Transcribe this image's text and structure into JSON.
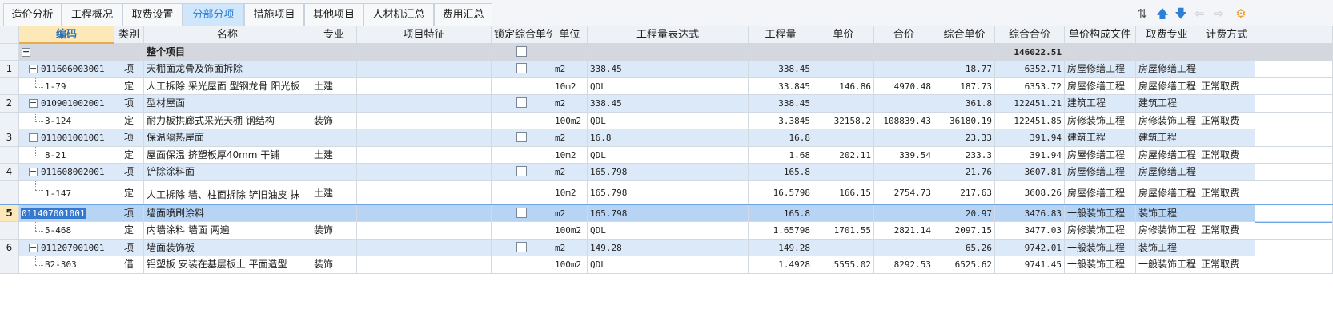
{
  "tabs": [
    {
      "label": "造价分析",
      "active": false
    },
    {
      "label": "工程概况",
      "active": false
    },
    {
      "label": "取费设置",
      "active": false
    },
    {
      "label": "分部分项",
      "active": true
    },
    {
      "label": "措施项目",
      "active": false
    },
    {
      "label": "其他项目",
      "active": false
    },
    {
      "label": "人材机汇总",
      "active": false
    },
    {
      "label": "费用汇总",
      "active": false
    }
  ],
  "toolbar_icons": [
    "sort-icon",
    "move-up-icon",
    "move-down-icon",
    "outdent-icon",
    "indent-icon",
    "settings-icon"
  ],
  "columns": [
    "编码",
    "类别",
    "名称",
    "专业",
    "项目特征",
    "锁定综合单价",
    "单位",
    "工程量表达式",
    "工程量",
    "单价",
    "合价",
    "综合单价",
    "综合合价",
    "单价构成文件",
    "取费专业",
    "计费方式"
  ],
  "total_row": {
    "code": "",
    "name": "整个项目",
    "total": "146022.51"
  },
  "rows": [
    {
      "idx": "1",
      "kind": "item",
      "code": "011606003001",
      "type": "项",
      "name": "天棚面龙骨及饰面拆除",
      "spec": "",
      "unit": "m2",
      "expr": "338.45",
      "qty": "338.45",
      "price": "",
      "amount": "",
      "uprice": "18.77",
      "utotal": "6352.71",
      "file": "房屋修缮工程",
      "fee": "房屋修缮工程",
      "mode": ""
    },
    {
      "idx": "",
      "kind": "quota",
      "code": "1-79",
      "type": "定",
      "name": "人工拆除 采光屋面 型钢龙骨 阳光板",
      "spec": "土建",
      "unit": "10m2",
      "expr": "QDL",
      "qty": "33.845",
      "price": "146.86",
      "amount": "4970.48",
      "uprice": "187.73",
      "utotal": "6353.72",
      "file": "房屋修缮工程",
      "fee": "房屋修缮工程",
      "mode": "正常取费"
    },
    {
      "idx": "2",
      "kind": "item",
      "code": "010901002001",
      "type": "项",
      "name": "型材屋面",
      "spec": "",
      "unit": "m2",
      "expr": "338.45",
      "qty": "338.45",
      "price": "",
      "amount": "",
      "uprice": "361.8",
      "utotal": "122451.21",
      "file": "建筑工程",
      "fee": "建筑工程",
      "mode": ""
    },
    {
      "idx": "",
      "kind": "quota",
      "code": "3-124",
      "type": "定",
      "name": "耐力板拱廊式采光天棚 钢结构",
      "spec": "装饰",
      "unit": "100m2",
      "expr": "QDL",
      "qty": "3.3845",
      "price": "32158.2",
      "amount": "108839.43",
      "uprice": "36180.19",
      "utotal": "122451.85",
      "file": "房修装饰工程",
      "fee": "房修装饰工程",
      "mode": "正常取费"
    },
    {
      "idx": "3",
      "kind": "item",
      "code": "011001001001",
      "type": "项",
      "name": "保温隔热屋面",
      "spec": "",
      "unit": "m2",
      "expr": "16.8",
      "qty": "16.8",
      "price": "",
      "amount": "",
      "uprice": "23.33",
      "utotal": "391.94",
      "file": "建筑工程",
      "fee": "建筑工程",
      "mode": ""
    },
    {
      "idx": "",
      "kind": "quota",
      "code": "8-21",
      "type": "定",
      "name": "屋面保温 挤塑板厚40mm 干铺",
      "spec": "土建",
      "unit": "10m2",
      "expr": "QDL",
      "qty": "1.68",
      "price": "202.11",
      "amount": "339.54",
      "uprice": "233.3",
      "utotal": "391.94",
      "file": "房屋修缮工程",
      "fee": "房屋修缮工程",
      "mode": "正常取费"
    },
    {
      "idx": "4",
      "kind": "item",
      "code": "011608002001",
      "type": "项",
      "name": "铲除涂料面",
      "spec": "",
      "unit": "m2",
      "expr": "165.798",
      "qty": "165.8",
      "price": "",
      "amount": "",
      "uprice": "21.76",
      "utotal": "3607.81",
      "file": "房屋修缮工程",
      "fee": "房屋修缮工程",
      "mode": ""
    },
    {
      "idx": "",
      "kind": "quota",
      "code": "1-147",
      "type": "定",
      "name": "人工拆除 墙、柱面拆除 铲旧油皮 抹灰面",
      "spec": "土建",
      "unit": "10m2",
      "expr": "165.798",
      "qty": "16.5798",
      "price": "166.15",
      "amount": "2754.73",
      "uprice": "217.63",
      "utotal": "3608.26",
      "file": "房屋修缮工程",
      "fee": "房屋修缮工程",
      "mode": "正常取费",
      "tall": true
    },
    {
      "idx": "5",
      "kind": "sel",
      "code": "011407001001",
      "type": "项",
      "name": "墙面喷刷涂料",
      "spec": "",
      "unit": "m2",
      "expr": "165.798",
      "qty": "165.8",
      "price": "",
      "amount": "",
      "uprice": "20.97",
      "utotal": "3476.83",
      "file": "一般装饰工程",
      "fee": "装饰工程",
      "mode": ""
    },
    {
      "idx": "",
      "kind": "quota",
      "code": "5-468",
      "type": "定",
      "name": "内墙涂料 墙面 两遍",
      "spec": "装饰",
      "unit": "100m2",
      "expr": "QDL",
      "qty": "1.65798",
      "price": "1701.55",
      "amount": "2821.14",
      "uprice": "2097.15",
      "utotal": "3477.03",
      "file": "房修装饰工程",
      "fee": "房修装饰工程",
      "mode": "正常取费"
    },
    {
      "idx": "6",
      "kind": "item",
      "code": "011207001001",
      "type": "项",
      "name": "墙面装饰板",
      "spec": "",
      "unit": "m2",
      "expr": "149.28",
      "qty": "149.28",
      "price": "",
      "amount": "",
      "uprice": "65.26",
      "utotal": "9742.01",
      "file": "一般装饰工程",
      "fee": "装饰工程",
      "mode": ""
    },
    {
      "idx": "",
      "kind": "quota",
      "code": "B2-303",
      "type": "借",
      "name": "铝塑板 安装在基层板上 平面造型",
      "spec": "装饰",
      "unit": "100m2",
      "expr": "QDL",
      "qty": "1.4928",
      "price": "5555.02",
      "amount": "8292.53",
      "uprice": "6525.62",
      "utotal": "9741.45",
      "file": "一般装饰工程",
      "fee": "一般装饰工程",
      "mode": "正常取费"
    }
  ]
}
